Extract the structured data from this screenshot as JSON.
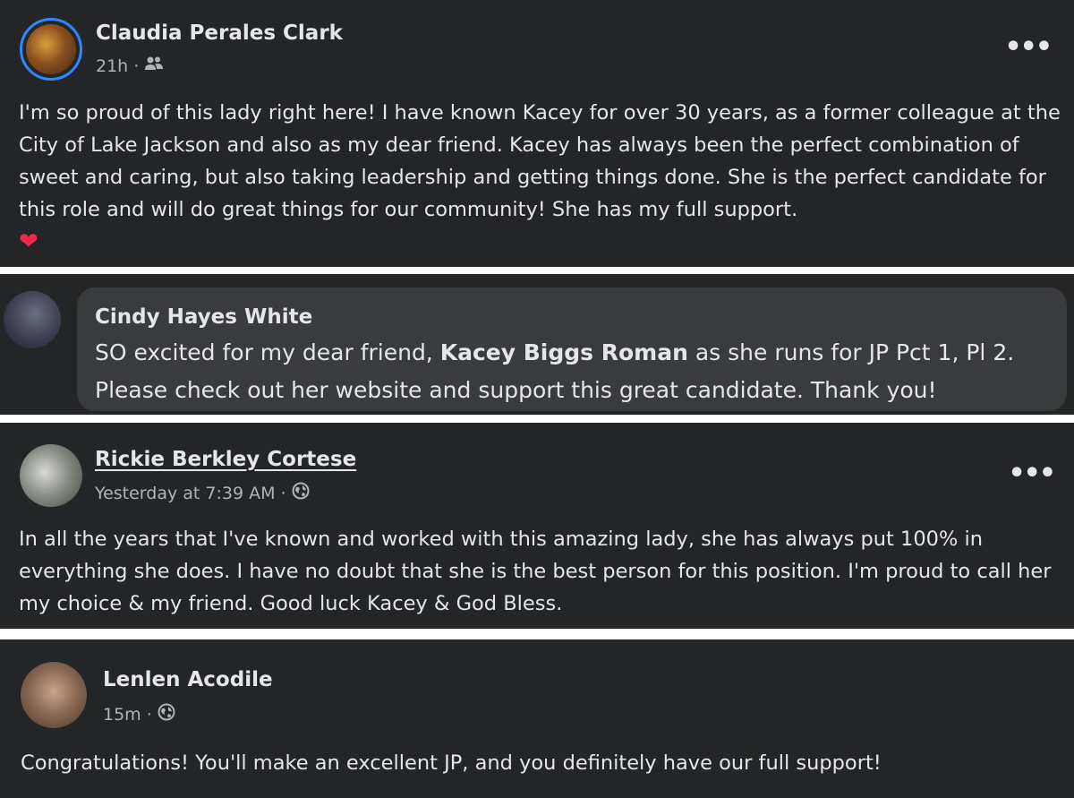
{
  "posts": [
    {
      "author": "Claudia Perales Clark",
      "time": "21h",
      "separator": "·",
      "audience_icon": "friends-icon",
      "text": "I'm so proud of this lady right here! I have known Kacey for over 30 years, as a former colleague at the City of Lake Jackson and also as my dear friend. Kacey has always been the perfect combination of sweet and caring, but also taking leadership and getting things done. She is the perfect candidate for this role and will do great things for our community! She has my full support.",
      "emoji": "❤"
    },
    {
      "author": "Cindy Hayes White",
      "text_before": "SO excited for my dear friend, ",
      "mention": "Kacey Biggs Roman",
      "text_after": " as she runs for JP Pct 1, Pl 2. Please check out her website and support this great candidate. Thank you!"
    },
    {
      "author": "Rickie Berkley Cortese",
      "time": "Yesterday at 7:39 AM",
      "separator": "·",
      "audience_icon": "globe-icon",
      "text": "In all the years that I've known and worked with this amazing lady, she has always put 100% in everything she does. I have no doubt that she is the best person for this position. I'm proud to call her my choice & my friend. Good luck Kacey & God Bless."
    },
    {
      "author": "Lenlen Acodile",
      "time": "15m",
      "separator": "·",
      "audience_icon": "globe-icon",
      "text": "Congratulations! You'll make an excellent JP, and you definitely have our full support!"
    }
  ],
  "more_label": "•••",
  "colors": {
    "card_bg": "#242526",
    "bubble_bg": "#3a3b3c",
    "text": "#e4e6eb",
    "secondary_text": "#b0b3b8",
    "avatar_ring": "#2d88ff",
    "heart": "#f02849"
  }
}
